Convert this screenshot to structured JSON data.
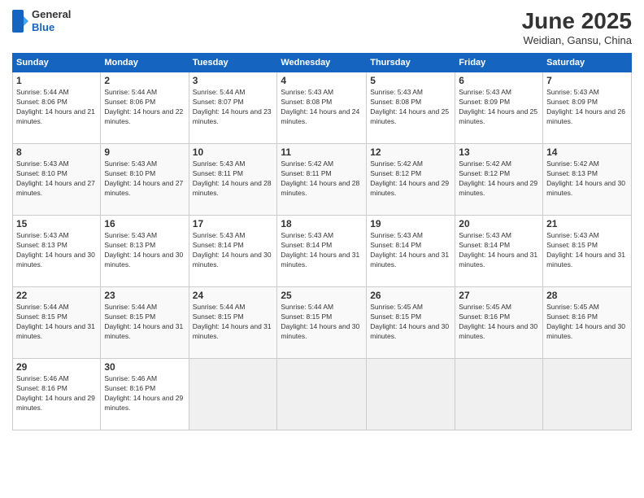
{
  "logo": {
    "general": "General",
    "blue": "Blue"
  },
  "header": {
    "month": "June 2025",
    "location": "Weidian, Gansu, China"
  },
  "weekdays": [
    "Sunday",
    "Monday",
    "Tuesday",
    "Wednesday",
    "Thursday",
    "Friday",
    "Saturday"
  ],
  "weeks": [
    [
      {
        "day": "1",
        "sunrise": "5:44 AM",
        "sunset": "8:06 PM",
        "daylight": "14 hours and 21 minutes."
      },
      {
        "day": "2",
        "sunrise": "5:44 AM",
        "sunset": "8:06 PM",
        "daylight": "14 hours and 22 minutes."
      },
      {
        "day": "3",
        "sunrise": "5:44 AM",
        "sunset": "8:07 PM",
        "daylight": "14 hours and 23 minutes."
      },
      {
        "day": "4",
        "sunrise": "5:43 AM",
        "sunset": "8:08 PM",
        "daylight": "14 hours and 24 minutes."
      },
      {
        "day": "5",
        "sunrise": "5:43 AM",
        "sunset": "8:08 PM",
        "daylight": "14 hours and 25 minutes."
      },
      {
        "day": "6",
        "sunrise": "5:43 AM",
        "sunset": "8:09 PM",
        "daylight": "14 hours and 25 minutes."
      },
      {
        "day": "7",
        "sunrise": "5:43 AM",
        "sunset": "8:09 PM",
        "daylight": "14 hours and 26 minutes."
      }
    ],
    [
      {
        "day": "8",
        "sunrise": "5:43 AM",
        "sunset": "8:10 PM",
        "daylight": "14 hours and 27 minutes."
      },
      {
        "day": "9",
        "sunrise": "5:43 AM",
        "sunset": "8:10 PM",
        "daylight": "14 hours and 27 minutes."
      },
      {
        "day": "10",
        "sunrise": "5:43 AM",
        "sunset": "8:11 PM",
        "daylight": "14 hours and 28 minutes."
      },
      {
        "day": "11",
        "sunrise": "5:42 AM",
        "sunset": "8:11 PM",
        "daylight": "14 hours and 28 minutes."
      },
      {
        "day": "12",
        "sunrise": "5:42 AM",
        "sunset": "8:12 PM",
        "daylight": "14 hours and 29 minutes."
      },
      {
        "day": "13",
        "sunrise": "5:42 AM",
        "sunset": "8:12 PM",
        "daylight": "14 hours and 29 minutes."
      },
      {
        "day": "14",
        "sunrise": "5:42 AM",
        "sunset": "8:13 PM",
        "daylight": "14 hours and 30 minutes."
      }
    ],
    [
      {
        "day": "15",
        "sunrise": "5:43 AM",
        "sunset": "8:13 PM",
        "daylight": "14 hours and 30 minutes."
      },
      {
        "day": "16",
        "sunrise": "5:43 AM",
        "sunset": "8:13 PM",
        "daylight": "14 hours and 30 minutes."
      },
      {
        "day": "17",
        "sunrise": "5:43 AM",
        "sunset": "8:14 PM",
        "daylight": "14 hours and 30 minutes."
      },
      {
        "day": "18",
        "sunrise": "5:43 AM",
        "sunset": "8:14 PM",
        "daylight": "14 hours and 31 minutes."
      },
      {
        "day": "19",
        "sunrise": "5:43 AM",
        "sunset": "8:14 PM",
        "daylight": "14 hours and 31 minutes."
      },
      {
        "day": "20",
        "sunrise": "5:43 AM",
        "sunset": "8:14 PM",
        "daylight": "14 hours and 31 minutes."
      },
      {
        "day": "21",
        "sunrise": "5:43 AM",
        "sunset": "8:15 PM",
        "daylight": "14 hours and 31 minutes."
      }
    ],
    [
      {
        "day": "22",
        "sunrise": "5:44 AM",
        "sunset": "8:15 PM",
        "daylight": "14 hours and 31 minutes."
      },
      {
        "day": "23",
        "sunrise": "5:44 AM",
        "sunset": "8:15 PM",
        "daylight": "14 hours and 31 minutes."
      },
      {
        "day": "24",
        "sunrise": "5:44 AM",
        "sunset": "8:15 PM",
        "daylight": "14 hours and 31 minutes."
      },
      {
        "day": "25",
        "sunrise": "5:44 AM",
        "sunset": "8:15 PM",
        "daylight": "14 hours and 30 minutes."
      },
      {
        "day": "26",
        "sunrise": "5:45 AM",
        "sunset": "8:15 PM",
        "daylight": "14 hours and 30 minutes."
      },
      {
        "day": "27",
        "sunrise": "5:45 AM",
        "sunset": "8:16 PM",
        "daylight": "14 hours and 30 minutes."
      },
      {
        "day": "28",
        "sunrise": "5:45 AM",
        "sunset": "8:16 PM",
        "daylight": "14 hours and 30 minutes."
      }
    ],
    [
      {
        "day": "29",
        "sunrise": "5:46 AM",
        "sunset": "8:16 PM",
        "daylight": "14 hours and 29 minutes."
      },
      {
        "day": "30",
        "sunrise": "5:46 AM",
        "sunset": "8:16 PM",
        "daylight": "14 hours and 29 minutes."
      },
      null,
      null,
      null,
      null,
      null
    ]
  ]
}
